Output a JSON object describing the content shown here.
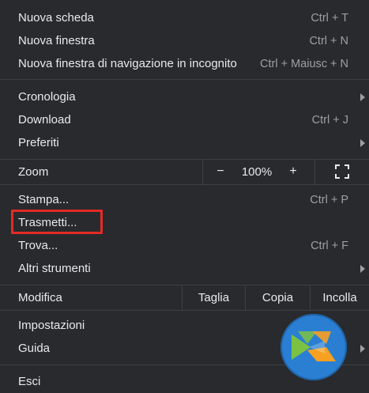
{
  "menu": {
    "new_tab": {
      "label": "Nuova scheda",
      "shortcut": "Ctrl + T"
    },
    "new_window": {
      "label": "Nuova finestra",
      "shortcut": "Ctrl + N"
    },
    "incognito": {
      "label": "Nuova finestra di navigazione in incognito",
      "shortcut": "Ctrl + Maiusc + N"
    },
    "history": {
      "label": "Cronologia"
    },
    "downloads": {
      "label": "Download",
      "shortcut": "Ctrl + J"
    },
    "bookmarks": {
      "label": "Preferiti"
    },
    "zoom": {
      "label": "Zoom",
      "minus": "−",
      "value": "100%",
      "plus": "+"
    },
    "print": {
      "label": "Stampa...",
      "shortcut": "Ctrl + P"
    },
    "cast": {
      "label": "Trasmetti..."
    },
    "find": {
      "label": "Trova...",
      "shortcut": "Ctrl + F"
    },
    "more_tools": {
      "label": "Altri strumenti"
    },
    "edit": {
      "label": "Modifica",
      "cut": "Taglia",
      "copy": "Copia",
      "paste": "Incolla"
    },
    "settings": {
      "label": "Impostazioni"
    },
    "help": {
      "label": "Guida"
    },
    "exit": {
      "label": "Esci"
    }
  },
  "colors": {
    "background": "#292a2d",
    "text": "#e8eaed",
    "shortcut": "#9aa0a6",
    "separator": "#3c4043",
    "highlight_box": "#e32b25",
    "logo_blue": "#2a7fd3",
    "logo_green": "#7cc242",
    "logo_orange": "#f7a021"
  },
  "icons": {
    "fullscreen": "fullscreen-icon",
    "submenu": "chevron-right-icon",
    "logo": "watermark-logo-icon"
  }
}
